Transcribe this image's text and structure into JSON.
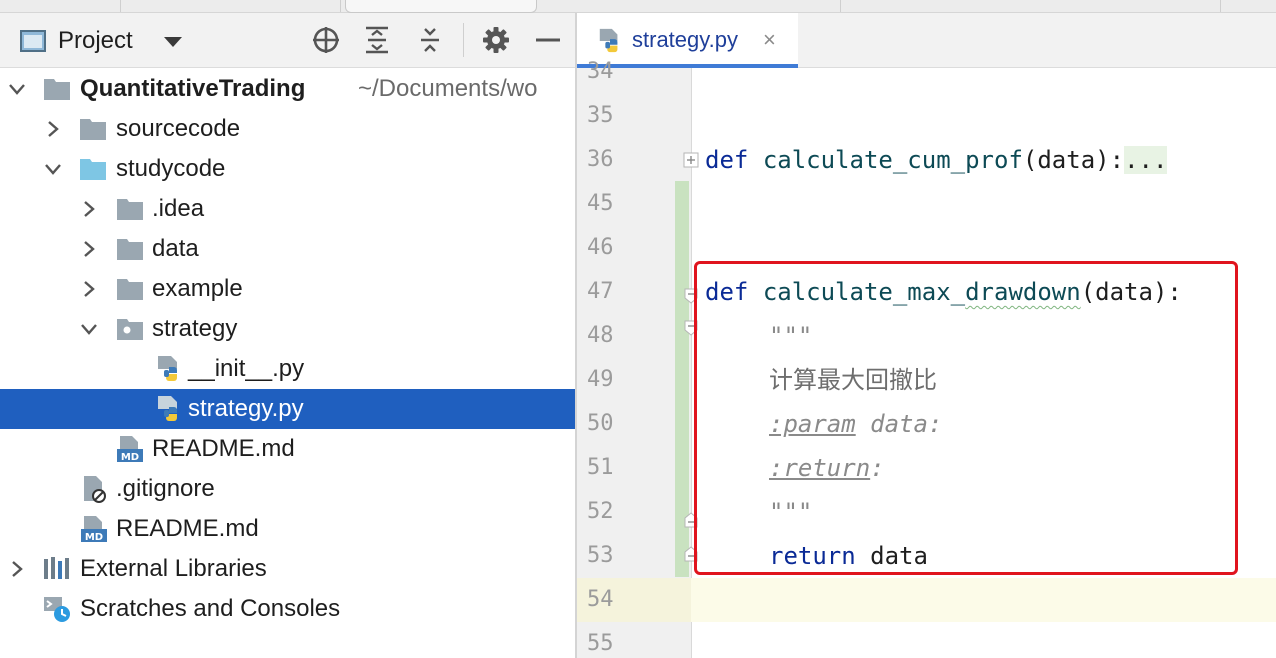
{
  "project_panel": {
    "title": "Project",
    "toolbar_icons": [
      "locate-icon",
      "expand-all-icon",
      "collapse-all-icon",
      "gear-icon",
      "minimize-icon"
    ],
    "tree": [
      {
        "label": "QuantitativeTrading",
        "path": "~/Documents/wo",
        "depth": 0,
        "expanded": true,
        "icon": "folder-icon",
        "bold": true
      },
      {
        "label": "sourcecode",
        "depth": 1,
        "expanded": false,
        "icon": "folder-icon"
      },
      {
        "label": "studycode",
        "depth": 1,
        "expanded": true,
        "icon": "source-folder-icon"
      },
      {
        "label": ".idea",
        "depth": 2,
        "expanded": false,
        "icon": "folder-icon"
      },
      {
        "label": "data",
        "depth": 2,
        "expanded": false,
        "icon": "folder-icon"
      },
      {
        "label": "example",
        "depth": 2,
        "expanded": false,
        "icon": "folder-icon"
      },
      {
        "label": "strategy",
        "depth": 2,
        "expanded": true,
        "icon": "package-icon"
      },
      {
        "label": "__init__.py",
        "depth": 3,
        "icon": "python-file-icon"
      },
      {
        "label": "strategy.py",
        "depth": 3,
        "icon": "python-file-icon",
        "selected": true
      },
      {
        "label": "README.md",
        "depth": 2,
        "icon": "markdown-file-icon"
      },
      {
        "label": ".gitignore",
        "depth": 1,
        "icon": "ignore-file-icon"
      },
      {
        "label": "README.md",
        "depth": 1,
        "icon": "markdown-file-icon"
      },
      {
        "label": "External Libraries",
        "depth": 0,
        "expanded": false,
        "icon": "libraries-icon"
      },
      {
        "label": "Scratches and Consoles",
        "depth": 0,
        "icon": "scratches-icon"
      }
    ]
  },
  "editor": {
    "tab": {
      "label": "strategy.py",
      "close": "×"
    },
    "lines": [
      {
        "num": "34",
        "text": ""
      },
      {
        "num": "35",
        "text": ""
      },
      {
        "num": "36",
        "kw": "def",
        "fn": "calculate_cum_prof",
        "rest": "(data):",
        "collapsed": "..."
      },
      {
        "num": "45",
        "text": ""
      },
      {
        "num": "46",
        "text": ""
      },
      {
        "num": "47",
        "kw": "def",
        "fn_a": "calculate_max_",
        "fn_b": "drawdown",
        "rest": "(data):"
      },
      {
        "num": "48",
        "doc": "\"\"\""
      },
      {
        "num": "49",
        "docplain": "计算最大回撤比"
      },
      {
        "num": "50",
        "tag": ":param",
        "doc": " data:"
      },
      {
        "num": "51",
        "tag": ":return",
        "doc": ":"
      },
      {
        "num": "52",
        "doc": "\"\"\""
      },
      {
        "num": "53",
        "kw": "return",
        "rest": " data"
      },
      {
        "num": "54",
        "text": ""
      },
      {
        "num": "55",
        "text": ""
      }
    ]
  },
  "colors": {
    "selection": "#1f5fbf",
    "keyword": "#0a2a96",
    "function": "#0d4a55",
    "highlight_box": "#e0141e",
    "change_bar": "#c9e2c0"
  }
}
